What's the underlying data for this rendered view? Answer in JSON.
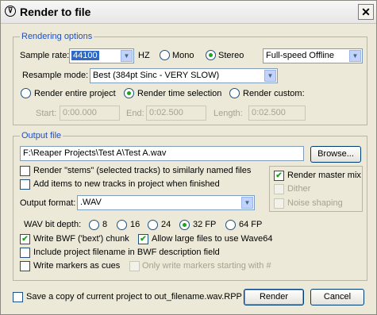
{
  "window": {
    "title": "Render to file",
    "close_glyph": "✕"
  },
  "rendering_options": {
    "group_title": "Rendering options",
    "sample_rate_label": "Sample rate:",
    "sample_rate_value": "44100",
    "hz_label": "HZ",
    "mono_label": "Mono",
    "stereo_label": "Stereo",
    "channels_selected": "Stereo",
    "speed_mode": "Full-speed Offline",
    "resample_label": "Resample mode:",
    "resample_value": "Best (384pt Sinc - VERY SLOW)",
    "render_entire_label": "Render entire project",
    "render_time_sel_label": "Render time selection",
    "render_custom_label": "Render custom:",
    "render_mode_selected": "Render time selection",
    "start_label": "Start:",
    "start_value": "0:00.000",
    "end_label": "End:",
    "end_value": "0:02.500",
    "length_label": "Length:",
    "length_value": "0:02.500"
  },
  "output_file": {
    "group_title": "Output file",
    "path": "F:\\Reaper Projects\\Test A\\Test A.wav",
    "browse_label": "Browse...",
    "stems_label": "Render \"stems\" (selected tracks) to similarly named files",
    "stems_checked": false,
    "add_items_label": "Add items to new tracks in project when finished",
    "add_items_checked": false,
    "render_master_label": "Render master mix",
    "render_master_checked": true,
    "dither_label": "Dither",
    "noise_shaping_label": "Noise shaping",
    "format_label": "Output format:",
    "format_value": ".WAV",
    "bitdepth_label": "WAV bit depth:",
    "bitdepth_options": [
      "8",
      "16",
      "24",
      "32 FP",
      "64 FP"
    ],
    "bitdepth_selected": "32 FP",
    "bwf_label": "Write BWF ('bext') chunk",
    "bwf_checked": true,
    "wave64_label": "Allow large files to use Wave64",
    "wave64_checked": true,
    "include_filename_label": "Include project filename in BWF description field",
    "include_filename_checked": false,
    "markers_label": "Write markers as cues",
    "markers_checked": false,
    "only_markers_label": "Only write markers starting with #"
  },
  "footer": {
    "save_copy_label": "Save a copy of current project to out_filename.wav.RPP",
    "save_copy_checked": false,
    "render_label": "Render",
    "cancel_label": "Cancel"
  },
  "colors": {
    "group_title": "#1f4fbf",
    "dialog_bg": "#ece9d8",
    "selection": "#316ac5",
    "check_mark": "#21a121"
  }
}
